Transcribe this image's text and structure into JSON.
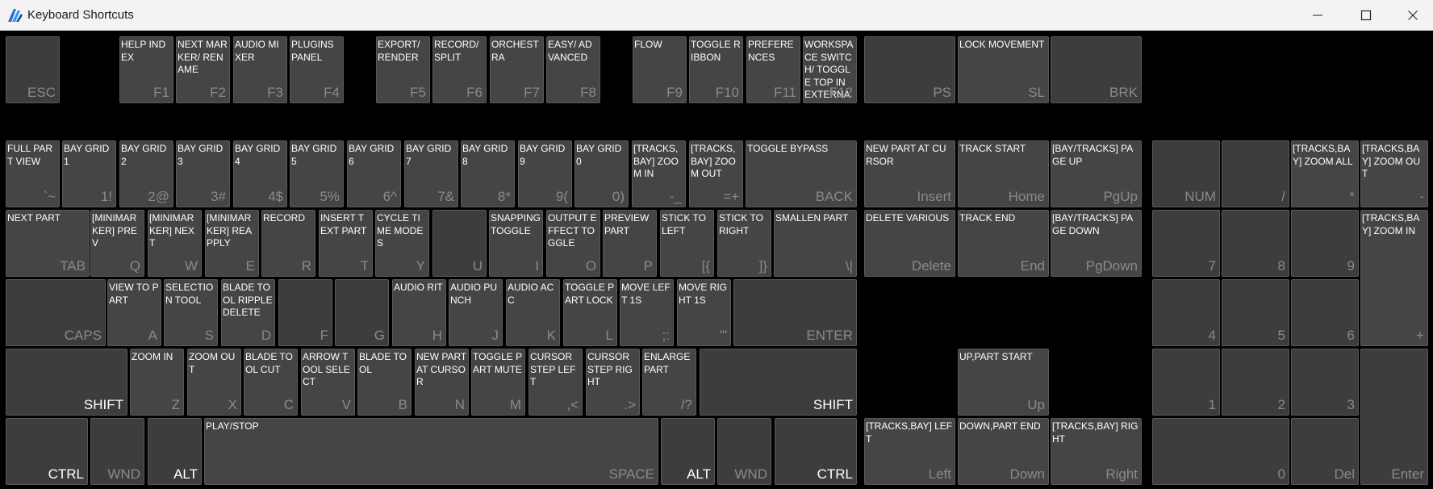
{
  "window": {
    "title": "Keyboard Shortcuts",
    "app_icon": "app-logo-icon",
    "controls": [
      "minimize-icon",
      "maximize-icon",
      "close-icon"
    ]
  },
  "keys": [
    {
      "id": "esc",
      "label": "ESC",
      "action": ""
    },
    {
      "id": "f1",
      "label": "F1",
      "action": "HELP INDEX"
    },
    {
      "id": "f2",
      "label": "F2",
      "action": "NEXT MARKER/ RENAME"
    },
    {
      "id": "f3",
      "label": "F3",
      "action": "AUDIO MIXER"
    },
    {
      "id": "f4",
      "label": "F4",
      "action": "PLUGINS PANEL"
    },
    {
      "id": "f5",
      "label": "F5",
      "action": "EXPORT/ RENDER"
    },
    {
      "id": "f6",
      "label": "F6",
      "action": "RECORD/ SPLIT"
    },
    {
      "id": "f7",
      "label": "F7",
      "action": "ORCHESTRA"
    },
    {
      "id": "f8",
      "label": "F8",
      "action": "EASY/ ADVANCED"
    },
    {
      "id": "f9",
      "label": "F9",
      "action": "FLOW"
    },
    {
      "id": "f10",
      "label": "F10",
      "action": "TOGGLE RIBBON"
    },
    {
      "id": "f11",
      "label": "F11",
      "action": "PREFERENCES"
    },
    {
      "id": "f12",
      "label": "F12",
      "action": "WORKSPACE SWITCH/ TOGGLE TOP IN EXTERNALS"
    },
    {
      "id": "ps",
      "label": "PS",
      "action": ""
    },
    {
      "id": "sl",
      "label": "SL",
      "action": "LOCK MOVEMENT"
    },
    {
      "id": "brk",
      "label": "BRK",
      "action": ""
    },
    {
      "id": "grave",
      "label": "`~",
      "action": "FULL PART VIEW"
    },
    {
      "id": "1",
      "label": "1!",
      "action": "BAY GRID 1"
    },
    {
      "id": "2",
      "label": "2@",
      "action": "BAY GRID 2"
    },
    {
      "id": "3",
      "label": "3#",
      "action": "BAY GRID 3"
    },
    {
      "id": "4",
      "label": "4$",
      "action": "BAY GRID 4"
    },
    {
      "id": "5",
      "label": "5%",
      "action": "BAY GRID 5"
    },
    {
      "id": "6",
      "label": "6^",
      "action": "BAY GRID 6"
    },
    {
      "id": "7",
      "label": "7&",
      "action": "BAY GRID 7"
    },
    {
      "id": "8",
      "label": "8*",
      "action": "BAY GRID 8"
    },
    {
      "id": "9",
      "label": "9(",
      "action": "BAY GRID 9"
    },
    {
      "id": "0",
      "label": "0)",
      "action": "BAY GRID 0"
    },
    {
      "id": "minus",
      "label": "-_",
      "action": "[TRACKS,BAY] ZOOM IN"
    },
    {
      "id": "equals",
      "label": "=+",
      "action": "[TRACKS,BAY] ZOOM OUT"
    },
    {
      "id": "back",
      "label": "BACK",
      "action": "TOGGLE BYPASS"
    },
    {
      "id": "insert",
      "label": "Insert",
      "action": "NEW PART AT CURSOR"
    },
    {
      "id": "home",
      "label": "Home",
      "action": "TRACK START"
    },
    {
      "id": "pgup",
      "label": "PgUp",
      "action": "[BAY/TRACKS] PAGE UP"
    },
    {
      "id": "num",
      "label": "NUM",
      "action": ""
    },
    {
      "id": "numdiv",
      "label": "/",
      "action": ""
    },
    {
      "id": "nummul",
      "label": "*",
      "action": "[TRACKS,BAY] ZOOM ALL"
    },
    {
      "id": "numsub",
      "label": "-",
      "action": "[TRACKS,BAY] ZOOM OUT"
    },
    {
      "id": "tab",
      "label": "TAB",
      "action": "NEXT PART"
    },
    {
      "id": "q",
      "label": "Q",
      "action": "[MINIMARKER] PREV"
    },
    {
      "id": "w",
      "label": "W",
      "action": "[MINIMARKER] NEXT"
    },
    {
      "id": "e",
      "label": "E",
      "action": "[MINIMARKER] REAPPLY"
    },
    {
      "id": "r",
      "label": "R",
      "action": "RECORD"
    },
    {
      "id": "t",
      "label": "T",
      "action": "INSERT TEXT PART"
    },
    {
      "id": "y",
      "label": "Y",
      "action": "CYCLE TIME MODES"
    },
    {
      "id": "u",
      "label": "U",
      "action": ""
    },
    {
      "id": "i",
      "label": "I",
      "action": "SNAPPING TOGGLE"
    },
    {
      "id": "o",
      "label": "O",
      "action": "OUTPUT EFFECT TOGGLE"
    },
    {
      "id": "p",
      "label": "P",
      "action": "PREVIEW PART"
    },
    {
      "id": "lbracket",
      "label": "[{",
      "action": "STICK TO LEFT"
    },
    {
      "id": "rbracket",
      "label": "]}",
      "action": "STICK TO RIGHT"
    },
    {
      "id": "backslash",
      "label": "\\|",
      "action": "SMALLEN PART"
    },
    {
      "id": "delete",
      "label": "Delete",
      "action": "DELETE VARIOUS"
    },
    {
      "id": "end",
      "label": "End",
      "action": "TRACK END"
    },
    {
      "id": "pgdown",
      "label": "PgDown",
      "action": "[BAY/TRACKS] PAGE DOWN"
    },
    {
      "id": "num7",
      "label": "7",
      "action": ""
    },
    {
      "id": "num8",
      "label": "8",
      "action": ""
    },
    {
      "id": "num9",
      "label": "9",
      "action": ""
    },
    {
      "id": "numadd",
      "label": "+",
      "action": "[TRACKS,BAY] ZOOM IN"
    },
    {
      "id": "caps",
      "label": "CAPS",
      "action": ""
    },
    {
      "id": "a",
      "label": "A",
      "action": "VIEW TO PART"
    },
    {
      "id": "s",
      "label": "S",
      "action": "SELECTION TOOL"
    },
    {
      "id": "d",
      "label": "D",
      "action": "BLADE TOOL RIPPLE DELETE"
    },
    {
      "id": "f",
      "label": "F",
      "action": ""
    },
    {
      "id": "g",
      "label": "G",
      "action": ""
    },
    {
      "id": "h",
      "label": "H",
      "action": "AUDIO RIT"
    },
    {
      "id": "j",
      "label": "J",
      "action": "AUDIO PUNCH"
    },
    {
      "id": "k",
      "label": "K",
      "action": "AUDIO ACC"
    },
    {
      "id": "l",
      "label": "L",
      "action": "TOGGLE PART LOCK"
    },
    {
      "id": "semicolon",
      "label": ";:",
      "action": "MOVE LEFT 1S"
    },
    {
      "id": "quote",
      "label": "'\"",
      "action": "MOVE RIGHT 1S"
    },
    {
      "id": "enter",
      "label": "ENTER",
      "action": ""
    },
    {
      "id": "num4",
      "label": "4",
      "action": ""
    },
    {
      "id": "num5",
      "label": "5",
      "action": ""
    },
    {
      "id": "num6",
      "label": "6",
      "action": ""
    },
    {
      "id": "lshift",
      "label": "SHIFT",
      "action": ""
    },
    {
      "id": "z",
      "label": "Z",
      "action": "ZOOM IN"
    },
    {
      "id": "x",
      "label": "X",
      "action": "ZOOM OUT"
    },
    {
      "id": "c",
      "label": "C",
      "action": "BLADE TOOL CUT"
    },
    {
      "id": "v",
      "label": "V",
      "action": "ARROW TOOL SELECT"
    },
    {
      "id": "b",
      "label": "B",
      "action": "BLADE TOOL"
    },
    {
      "id": "n",
      "label": "N",
      "action": "NEW PART AT CURSOR"
    },
    {
      "id": "m",
      "label": "M",
      "action": "TOGGLE PART MUTE"
    },
    {
      "id": "comma",
      "label": ",<",
      "action": "CURSOR STEP LEFT"
    },
    {
      "id": "period",
      "label": ".>",
      "action": "CURSOR STEP RIGHT"
    },
    {
      "id": "slash",
      "label": "/?",
      "action": "ENLARGE PART"
    },
    {
      "id": "rshift",
      "label": "SHIFT",
      "action": ""
    },
    {
      "id": "up",
      "label": "Up",
      "action": "UP,PART START"
    },
    {
      "id": "num1",
      "label": "1",
      "action": ""
    },
    {
      "id": "num2",
      "label": "2",
      "action": ""
    },
    {
      "id": "num3",
      "label": "3",
      "action": ""
    },
    {
      "id": "numenter",
      "label": "Enter",
      "action": ""
    },
    {
      "id": "lctrl",
      "label": "CTRL",
      "action": ""
    },
    {
      "id": "lwnd",
      "label": "WND",
      "action": ""
    },
    {
      "id": "lalt",
      "label": "ALT",
      "action": ""
    },
    {
      "id": "space",
      "label": "SPACE",
      "action": "PLAY/STOP"
    },
    {
      "id": "ralt",
      "label": "ALT",
      "action": ""
    },
    {
      "id": "rwnd",
      "label": "WND",
      "action": ""
    },
    {
      "id": "rctrl",
      "label": "CTRL",
      "action": ""
    },
    {
      "id": "left",
      "label": "Left",
      "action": "[TRACKS,BAY] LEFT"
    },
    {
      "id": "down",
      "label": "Down",
      "action": "DOWN,PART END"
    },
    {
      "id": "right",
      "label": "Right",
      "action": "[TRACKS,BAY] RIGHT"
    },
    {
      "id": "num0",
      "label": "0",
      "action": ""
    },
    {
      "id": "numdel",
      "label": "Del",
      "action": ""
    }
  ]
}
